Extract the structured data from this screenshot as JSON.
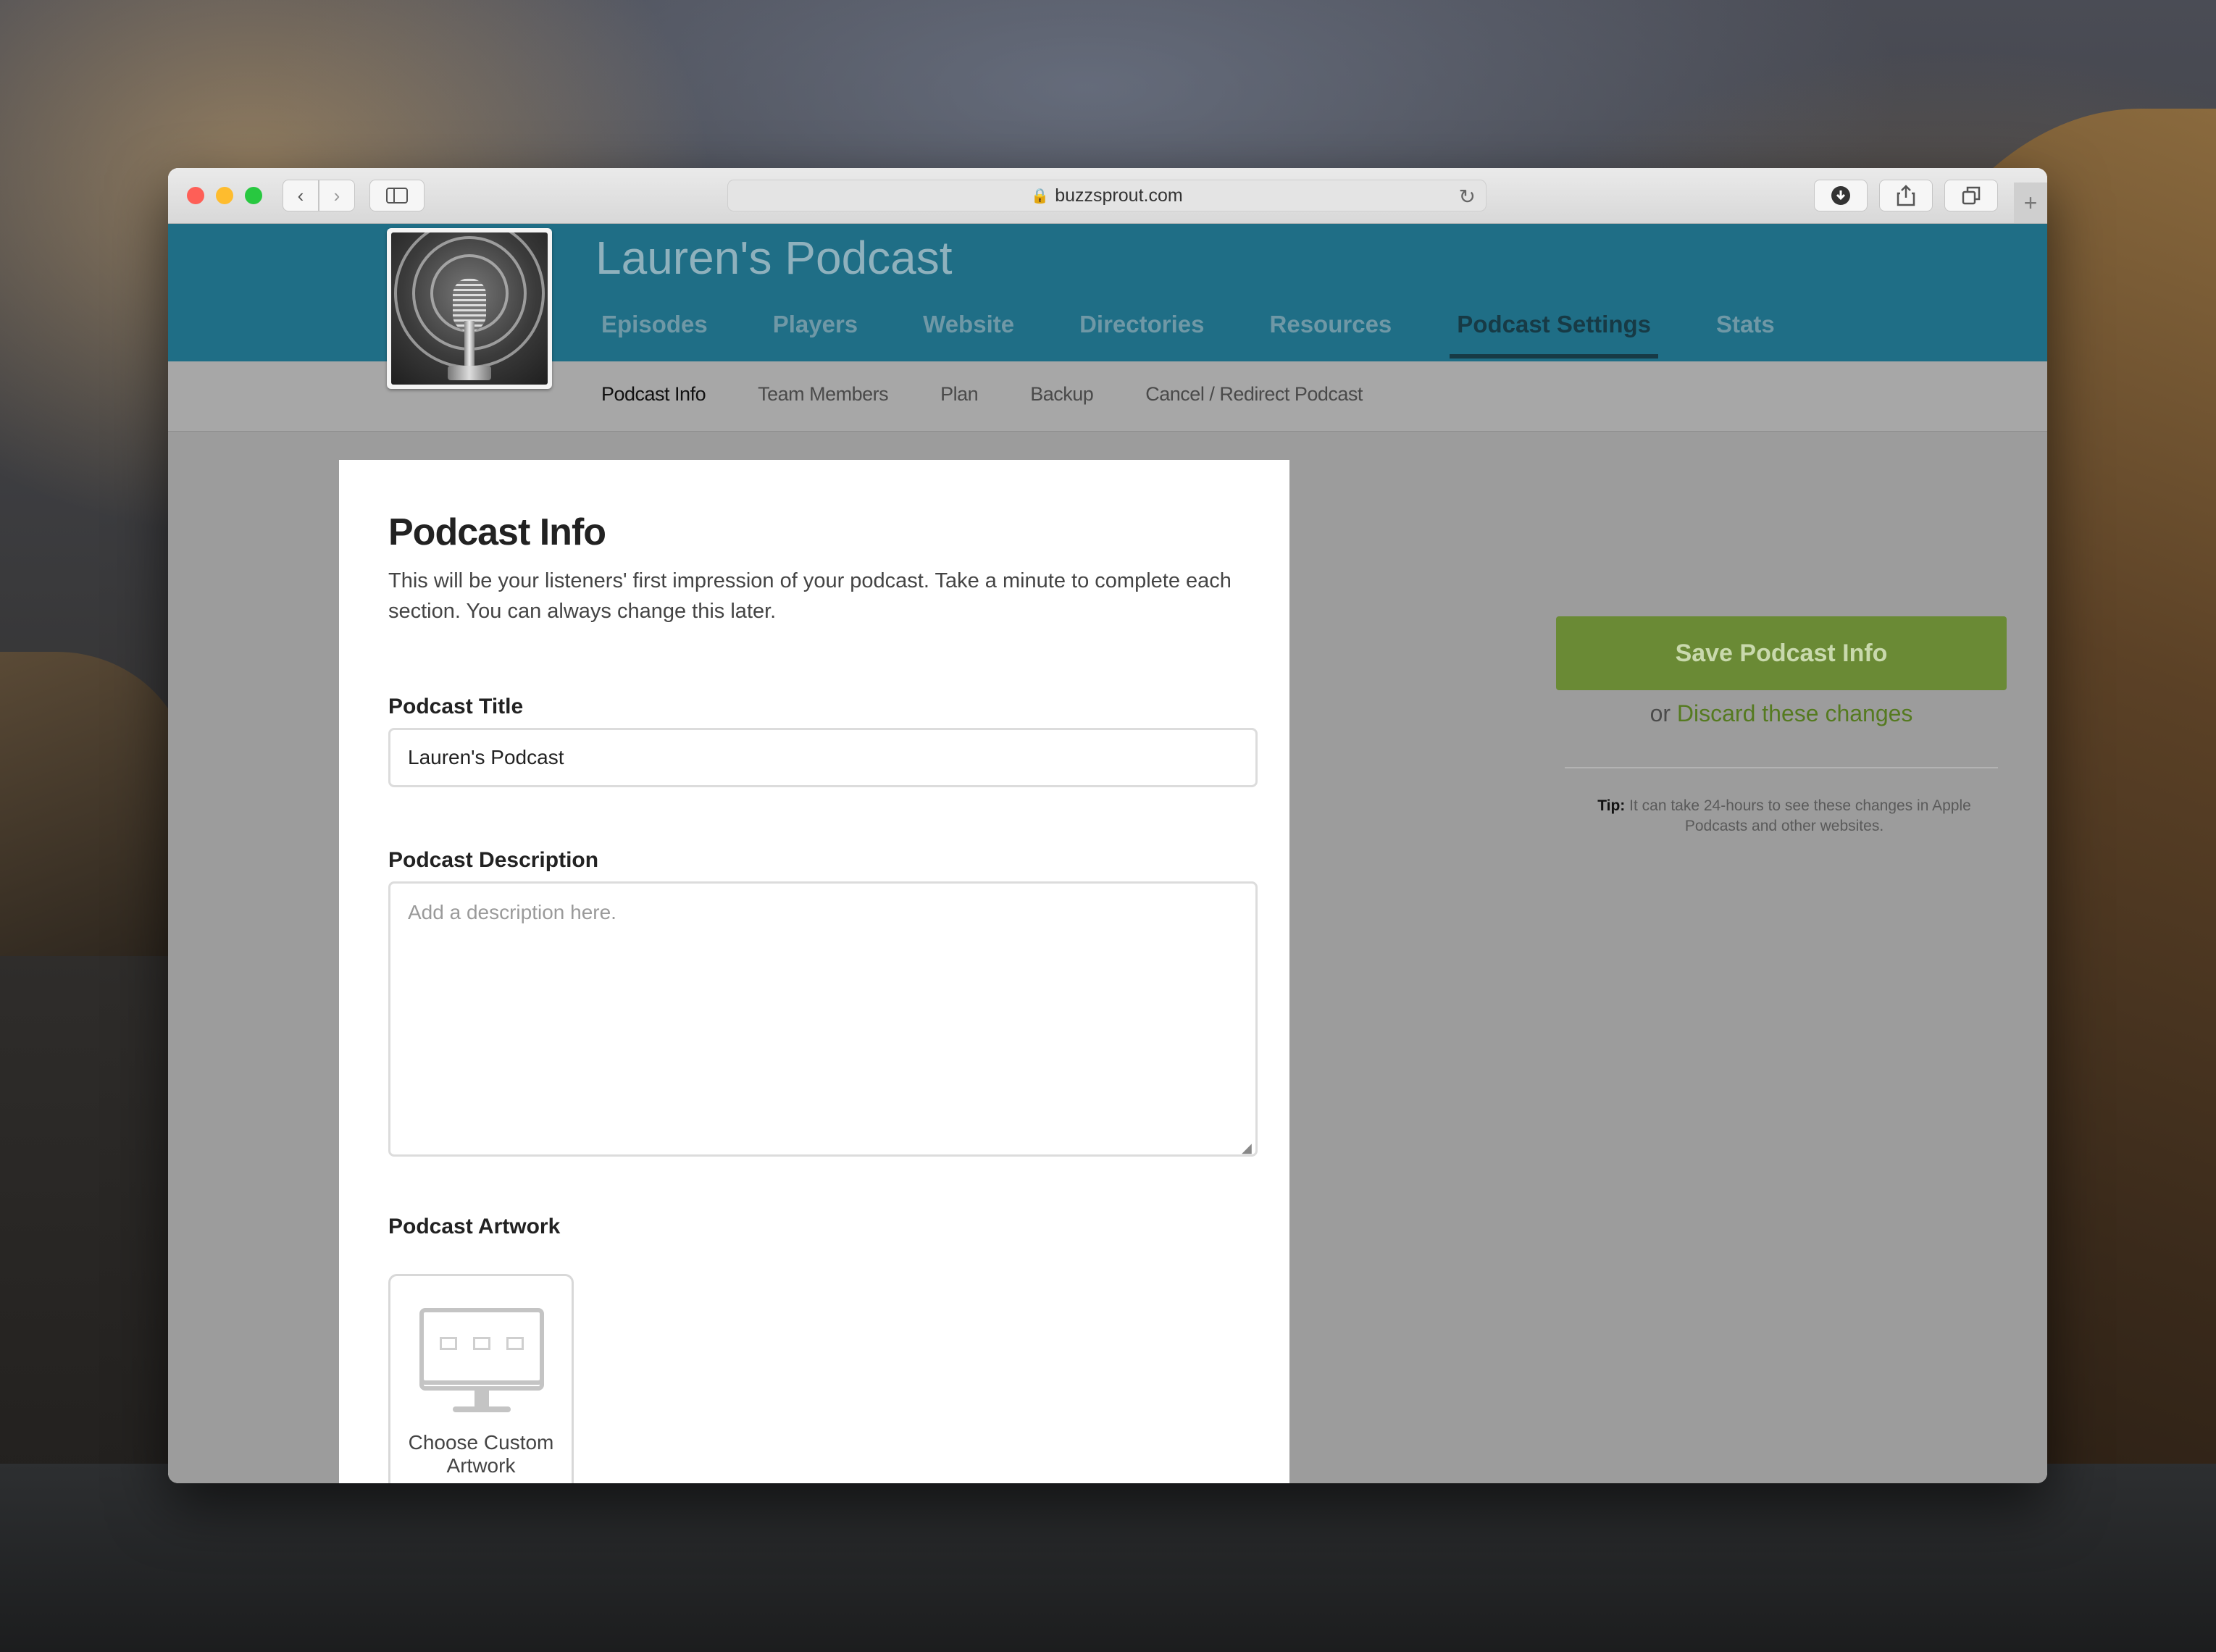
{
  "browser": {
    "url": "buzzsprout.com"
  },
  "header": {
    "podcast_title": "Lauren's Podcast",
    "nav": [
      {
        "label": "Episodes"
      },
      {
        "label": "Players"
      },
      {
        "label": "Website"
      },
      {
        "label": "Directories"
      },
      {
        "label": "Resources"
      },
      {
        "label": "Podcast Settings",
        "active": true
      },
      {
        "label": "Stats"
      }
    ]
  },
  "subnav": [
    {
      "label": "Podcast Info",
      "active": true
    },
    {
      "label": "Team Members"
    },
    {
      "label": "Plan"
    },
    {
      "label": "Backup"
    },
    {
      "label": "Cancel / Redirect Podcast"
    }
  ],
  "form": {
    "heading": "Podcast Info",
    "intro": "This will be your listeners' first impression of your podcast. Take a minute to complete each section. You can always change this later.",
    "title_label": "Podcast Title",
    "title_value": "Lauren's Podcast",
    "description_label": "Podcast Description",
    "description_placeholder": "Add a description here.",
    "artwork_label": "Podcast Artwork",
    "artwork_button": "Choose Custom Artwork"
  },
  "sidebar": {
    "save_label": "Save Podcast Info",
    "discard_prefix": "or",
    "discard_link": "Discard these changes",
    "tip_label": "Tip:",
    "tip_text": "It can take 24-hours to see these changes in Apple Podcasts and other websites."
  },
  "colors": {
    "header": "#1f6e86",
    "save_button": "#6a8a35",
    "link": "#557a20"
  }
}
